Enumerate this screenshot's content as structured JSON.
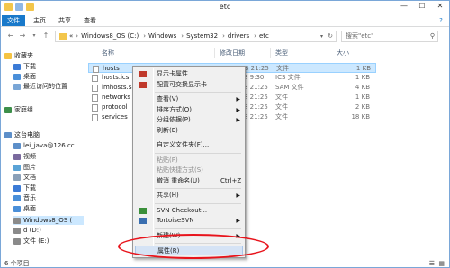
{
  "window": {
    "title": "etc",
    "minimize": "—",
    "maximize": "☐",
    "close": "✕"
  },
  "ribbon": {
    "tabs": [
      "文件",
      "主页",
      "共享",
      "查看"
    ]
  },
  "address": {
    "back": "←",
    "forward": "→",
    "up": "↑",
    "crumbs": [
      "Windows8_OS (C:)",
      "Windows",
      "System32",
      "drivers",
      "etc"
    ],
    "root_marker": "«",
    "search_placeholder": "搜索\"etc\""
  },
  "sidebar": {
    "items": [
      {
        "label": "收藏夹",
        "indent": 0,
        "color": "#f5c342"
      },
      {
        "label": "下载",
        "indent": 1,
        "color": "#3b7bd6"
      },
      {
        "label": "桌面",
        "indent": 1,
        "color": "#4a8fd9"
      },
      {
        "label": "最近访问的位置",
        "indent": 1,
        "color": "#7aa6d6"
      },
      {
        "label": "家庭组",
        "indent": 0,
        "color": "#3d8f4a"
      },
      {
        "label": "这台电脑",
        "indent": 0,
        "color": "#5d8fc9"
      },
      {
        "label": "lei_java@126.cc",
        "indent": 1,
        "color": "#5d8fc9"
      },
      {
        "label": "视频",
        "indent": 1,
        "color": "#7a6a9e"
      },
      {
        "label": "图片",
        "indent": 1,
        "color": "#5aa3d6"
      },
      {
        "label": "文档",
        "indent": 1,
        "color": "#8aa0b8"
      },
      {
        "label": "下载",
        "indent": 1,
        "color": "#3b7bd6"
      },
      {
        "label": "音乐",
        "indent": 1,
        "color": "#4a8fd9"
      },
      {
        "label": "桌面",
        "indent": 1,
        "color": "#4a8fd9"
      },
      {
        "label": "Windows8_OS (",
        "indent": 1,
        "color": "#8a8a8a",
        "selected": true
      },
      {
        "label": "d (D:)",
        "indent": 1,
        "color": "#8a8a8a"
      },
      {
        "label": "文件 (E:)",
        "indent": 1,
        "color": "#8a8a8a"
      }
    ]
  },
  "columns": {
    "name": "名称",
    "date": "修改日期",
    "type": "类型",
    "size": "大小"
  },
  "files": [
    {
      "name": "hosts",
      "date": "2013/7/8 21:25",
      "type": "文件",
      "size": "1 KB",
      "selected": true
    },
    {
      "name": "hosts.ics",
      "date": "2013/7/8 9:30",
      "type": "ICS 文件",
      "size": "1 KB"
    },
    {
      "name": "lmhosts.sam",
      "date": "2013/7/8 21:25",
      "type": "SAM 文件",
      "size": "4 KB"
    },
    {
      "name": "networks",
      "date": "2013/7/8 21:25",
      "type": "文件",
      "size": "1 KB"
    },
    {
      "name": "protocol",
      "date": "2013/7/8 21:25",
      "type": "文件",
      "size": "2 KB"
    },
    {
      "name": "services",
      "date": "2013/7/8 21:25",
      "type": "文件",
      "size": "18 KB"
    }
  ],
  "status": {
    "count": "6 个项目"
  },
  "context_menu": {
    "items": [
      {
        "label": "显示卡属性",
        "icon": "display-card-icon"
      },
      {
        "label": "配置可交换显示卡",
        "icon": "switchable-gpu-icon"
      },
      {
        "sep": true
      },
      {
        "label": "查看(V)",
        "arrow": "▶"
      },
      {
        "label": "排序方式(O)",
        "arrow": "▶"
      },
      {
        "label": "分组依据(P)",
        "arrow": "▶"
      },
      {
        "label": "刷新(E)"
      },
      {
        "sep": true
      },
      {
        "label": "自定义文件夹(F)..."
      },
      {
        "sep": true
      },
      {
        "label": "粘贴(P)",
        "disabled": true
      },
      {
        "label": "粘贴快捷方式(S)",
        "disabled": true
      },
      {
        "label": "撤消 重命名(U)",
        "shortcut": "Ctrl+Z"
      },
      {
        "sep": true
      },
      {
        "label": "共享(H)",
        "arrow": "▶"
      },
      {
        "sep": true
      },
      {
        "label": "SVN Checkout...",
        "icon": "svn-icon"
      },
      {
        "label": "TortoiseSVN",
        "arrow": "▶",
        "icon": "tortoisesvn-icon"
      },
      {
        "sep": true
      },
      {
        "label": "新建(W)",
        "arrow": "▶"
      },
      {
        "sep": true
      },
      {
        "label": "属性(R)",
        "highlighted": true
      }
    ]
  },
  "colors": {
    "accent": "#1979ca",
    "selection": "#cce8ff",
    "annotation": "#e8141c"
  }
}
